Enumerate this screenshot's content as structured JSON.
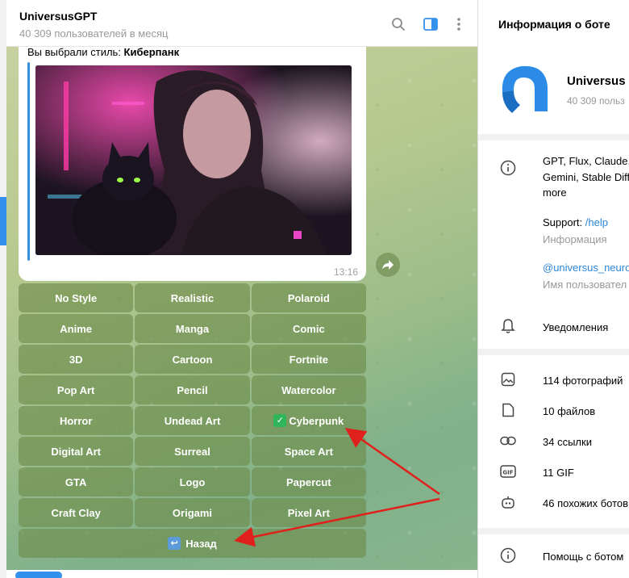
{
  "chat": {
    "title": "UniversusGPT",
    "subtitle": "40 309 пользователей в месяц",
    "message": {
      "prefix": "Вы выбрали стиль: ",
      "style": "Киберпанк",
      "time": "13:16"
    },
    "keyboard": [
      [
        "No Style",
        "Realistic",
        "Polaroid"
      ],
      [
        "Anime",
        "Manga",
        "Comic"
      ],
      [
        "3D",
        "Cartoon",
        "Fortnite"
      ],
      [
        "Pop Art",
        "Pencil",
        "Watercolor"
      ],
      [
        "Horror",
        "Undead Art",
        "Cyberpunk"
      ],
      [
        "Digital Art",
        "Surreal",
        "Space Art"
      ],
      [
        "GTA",
        "Logo",
        "Papercut"
      ],
      [
        "Craft Clay",
        "Origami",
        "Pixel Art"
      ],
      [
        "Назад"
      ]
    ],
    "selected_style": "Cyberpunk"
  },
  "panel": {
    "title": "Информация о боте",
    "bot_name": "Universus",
    "bot_sub": "40 309 польз",
    "description": [
      "GPT, Flux, Claude,",
      "Gemini, Stable Diff",
      "more"
    ],
    "support_label": "Support: ",
    "support_link": "/help",
    "info_label": "Информация",
    "username": "@universus_neuro",
    "username_label": "Имя пользовател",
    "notifications": "Уведомления",
    "media": {
      "photos": "114 фотографий",
      "files": "10 файлов",
      "links": "34 ссылки",
      "gifs": "11 GIF",
      "similar": "46 похожих ботов"
    },
    "help": "Помощь с ботом"
  },
  "colors": {
    "accent": "#3390ec",
    "keyboard_button": "#6c8a48",
    "arrow": "#e0201c"
  }
}
